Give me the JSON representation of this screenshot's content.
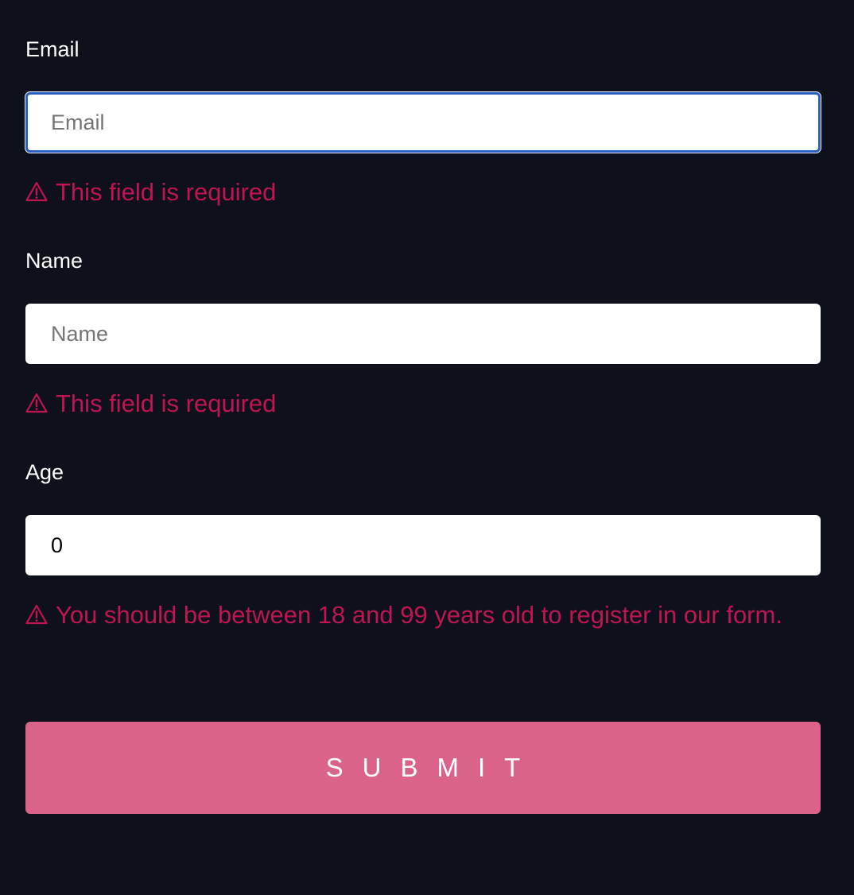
{
  "form": {
    "email": {
      "label": "Email",
      "placeholder": "Email",
      "value": "",
      "error": "This field is required"
    },
    "name": {
      "label": "Name",
      "placeholder": "Name",
      "value": "",
      "error": "This field is required"
    },
    "age": {
      "label": "Age",
      "value": "0",
      "error": "You should be between 18 and 99 years old to register in our form."
    },
    "submit_label": "SUBMIT"
  },
  "icons": {
    "error_icon": "warning-triangle-icon"
  },
  "colors": {
    "background": "#0e101c",
    "error": "#bf1650",
    "submit": "#db638a",
    "focus_border": "#2a5fc0"
  }
}
